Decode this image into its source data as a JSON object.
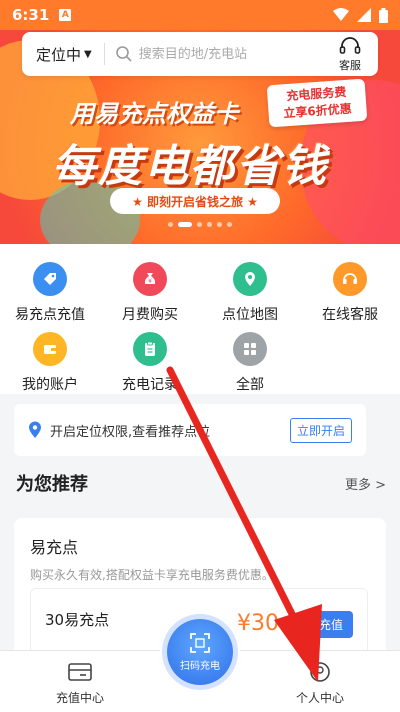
{
  "status_bar": {
    "time": "6:31",
    "badge": "A"
  },
  "header": {
    "location_label": "定位中",
    "search_placeholder": "搜索目的地/充电站",
    "service_label": "客服"
  },
  "banner": {
    "headline": "用易充点权益卡",
    "tag_line1": "充电服务费",
    "tag_line2": "立享6折优惠",
    "title": "每度电都省钱",
    "subtitle": "★ 即刻开启省钱之旅 ★"
  },
  "quick_menu": [
    {
      "label": "易充点充值",
      "icon": "tag-icon",
      "color": "#3a8ff0"
    },
    {
      "label": "月费购买",
      "icon": "money-bag-icon",
      "color": "#f04a5a"
    },
    {
      "label": "点位地图",
      "icon": "map-pin-icon",
      "color": "#2fbf8f"
    },
    {
      "label": "在线客服",
      "icon": "headset-icon",
      "color": "#ff9a2a"
    },
    {
      "label": "我的账户",
      "icon": "wallet-icon",
      "color": "#ffb624"
    },
    {
      "label": "充电记录",
      "icon": "clipboard-icon",
      "color": "#2fbf8f"
    },
    {
      "label": "全部",
      "icon": "grid-icon",
      "color": "#9ea3a8"
    }
  ],
  "location_notice": {
    "text": "开启定位权限,查看推荐点位",
    "button": "立即开启"
  },
  "recommend": {
    "title": "为您推荐",
    "more": "更多 >",
    "card_title": "易充点",
    "card_desc": "购买永久有效,搭配权益卡享充电服务费优惠。",
    "package_name": "30易充点",
    "package_price": "¥30",
    "package_button": "充值"
  },
  "tabbar": {
    "left": "充值中心",
    "center": "扫码充电",
    "right": "个人中心"
  },
  "colors": {
    "accent": "#ff7a2a",
    "primary_blue": "#3a7ff0",
    "arrow_red": "#e8261f"
  }
}
